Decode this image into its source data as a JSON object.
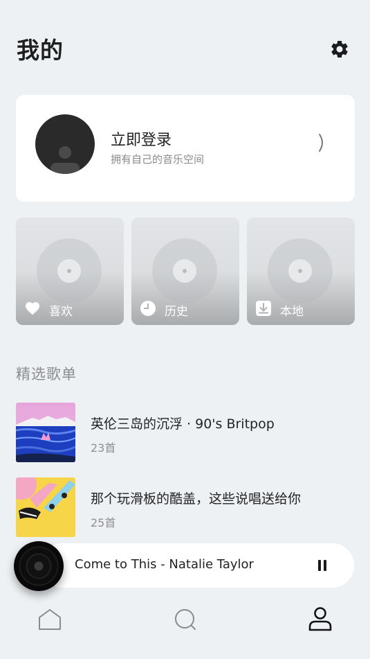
{
  "header": {
    "title": "我的",
    "settings_icon": "gear-icon"
  },
  "login": {
    "title": "立即登录",
    "subtitle": "拥有自己的音乐空间",
    "avatar_icon": "user-avatar-icon",
    "arrow_icon": "chevron-right-icon"
  },
  "tiles": [
    {
      "label": "喜欢",
      "icon": "heart-icon"
    },
    {
      "label": "历史",
      "icon": "clock-icon"
    },
    {
      "label": "本地",
      "icon": "download-icon"
    }
  ],
  "section": {
    "title": "精选歌单"
  },
  "playlists": [
    {
      "title": "英伦三岛的沉浮 · 90's Britpop",
      "count": "23首"
    },
    {
      "title": "那个玩滑板的酷盖，这些说唱送给你",
      "count": "25首"
    }
  ],
  "player": {
    "track": "Come to This - Natalie Taylor",
    "state_icon": "pause-icon"
  },
  "nav": {
    "items": [
      "home-icon",
      "search-icon",
      "profile-icon"
    ],
    "active": "profile-icon"
  },
  "colors": {
    "background": "#eef1f4",
    "card": "#ffffff",
    "text": "#1f1f1f",
    "muted": "#8c8c8c"
  }
}
